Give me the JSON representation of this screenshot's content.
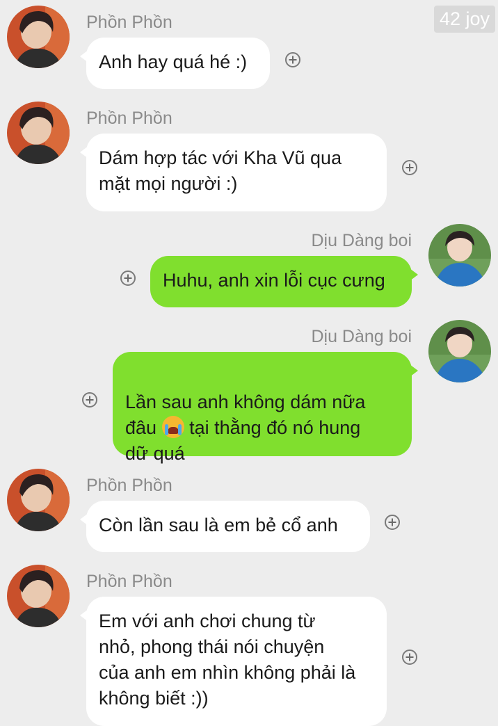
{
  "watermark": "42 joy",
  "messages": [
    {
      "sender": "Phồn Phồn",
      "text": "Anh hay quá hé :)"
    },
    {
      "sender": "Phồn Phồn",
      "text": "Dám hợp tác với Kha Vũ qua\nmặt mọi người :)"
    },
    {
      "sender": "Dịu Dàng boi",
      "text": "Huhu, anh xin lỗi cục cưng"
    },
    {
      "sender": "Dịu Dàng boi",
      "line1": "Lần sau anh không dám nữa",
      "line2_pre": "đâu ",
      "emoji": "loudly-crying-face-emoji",
      "line2_post": " tại thằng đó nó hung",
      "line3": "dữ quá"
    },
    {
      "sender": "Phồn Phồn",
      "text": "Còn lần sau là em bẻ cổ anh"
    },
    {
      "sender": "Phồn Phồn",
      "text": "Em với anh chơi chung từ\nnhỏ, phong thái nói chuyện\ncủa anh em nhìn không phải là\nkhông biết :))"
    }
  ],
  "colors": {
    "background": "#ededed",
    "incoming_bubble": "#ffffff",
    "outgoing_bubble": "#80df2e",
    "sender_name": "#8a8a8a"
  },
  "icons": {
    "add_reaction": "plus-circle-icon",
    "avatar_left": "avatar-phon-phon",
    "avatar_right": "avatar-diu-dang-boi"
  }
}
